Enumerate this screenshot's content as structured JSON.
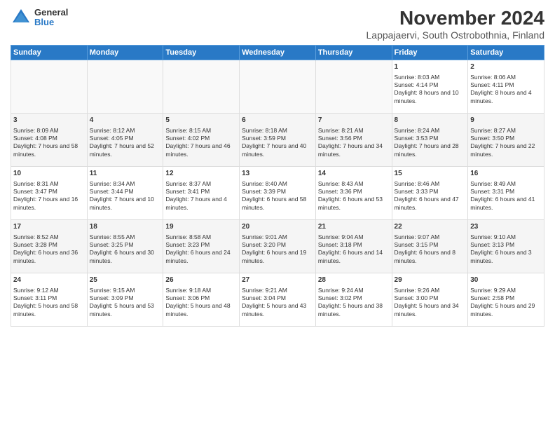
{
  "logo": {
    "general": "General",
    "blue": "Blue"
  },
  "title": "November 2024",
  "subtitle": "Lappajaervi, South Ostrobothnia, Finland",
  "days_of_week": [
    "Sunday",
    "Monday",
    "Tuesday",
    "Wednesday",
    "Thursday",
    "Friday",
    "Saturday"
  ],
  "weeks": [
    [
      {
        "day": "",
        "content": ""
      },
      {
        "day": "",
        "content": ""
      },
      {
        "day": "",
        "content": ""
      },
      {
        "day": "",
        "content": ""
      },
      {
        "day": "",
        "content": ""
      },
      {
        "day": "1",
        "content": "Sunrise: 8:03 AM\nSunset: 4:14 PM\nDaylight: 8 hours and 10 minutes."
      },
      {
        "day": "2",
        "content": "Sunrise: 8:06 AM\nSunset: 4:11 PM\nDaylight: 8 hours and 4 minutes."
      }
    ],
    [
      {
        "day": "3",
        "content": "Sunrise: 8:09 AM\nSunset: 4:08 PM\nDaylight: 7 hours and 58 minutes."
      },
      {
        "day": "4",
        "content": "Sunrise: 8:12 AM\nSunset: 4:05 PM\nDaylight: 7 hours and 52 minutes."
      },
      {
        "day": "5",
        "content": "Sunrise: 8:15 AM\nSunset: 4:02 PM\nDaylight: 7 hours and 46 minutes."
      },
      {
        "day": "6",
        "content": "Sunrise: 8:18 AM\nSunset: 3:59 PM\nDaylight: 7 hours and 40 minutes."
      },
      {
        "day": "7",
        "content": "Sunrise: 8:21 AM\nSunset: 3:56 PM\nDaylight: 7 hours and 34 minutes."
      },
      {
        "day": "8",
        "content": "Sunrise: 8:24 AM\nSunset: 3:53 PM\nDaylight: 7 hours and 28 minutes."
      },
      {
        "day": "9",
        "content": "Sunrise: 8:27 AM\nSunset: 3:50 PM\nDaylight: 7 hours and 22 minutes."
      }
    ],
    [
      {
        "day": "10",
        "content": "Sunrise: 8:31 AM\nSunset: 3:47 PM\nDaylight: 7 hours and 16 minutes."
      },
      {
        "day": "11",
        "content": "Sunrise: 8:34 AM\nSunset: 3:44 PM\nDaylight: 7 hours and 10 minutes."
      },
      {
        "day": "12",
        "content": "Sunrise: 8:37 AM\nSunset: 3:41 PM\nDaylight: 7 hours and 4 minutes."
      },
      {
        "day": "13",
        "content": "Sunrise: 8:40 AM\nSunset: 3:39 PM\nDaylight: 6 hours and 58 minutes."
      },
      {
        "day": "14",
        "content": "Sunrise: 8:43 AM\nSunset: 3:36 PM\nDaylight: 6 hours and 53 minutes."
      },
      {
        "day": "15",
        "content": "Sunrise: 8:46 AM\nSunset: 3:33 PM\nDaylight: 6 hours and 47 minutes."
      },
      {
        "day": "16",
        "content": "Sunrise: 8:49 AM\nSunset: 3:31 PM\nDaylight: 6 hours and 41 minutes."
      }
    ],
    [
      {
        "day": "17",
        "content": "Sunrise: 8:52 AM\nSunset: 3:28 PM\nDaylight: 6 hours and 36 minutes."
      },
      {
        "day": "18",
        "content": "Sunrise: 8:55 AM\nSunset: 3:25 PM\nDaylight: 6 hours and 30 minutes."
      },
      {
        "day": "19",
        "content": "Sunrise: 8:58 AM\nSunset: 3:23 PM\nDaylight: 6 hours and 24 minutes."
      },
      {
        "day": "20",
        "content": "Sunrise: 9:01 AM\nSunset: 3:20 PM\nDaylight: 6 hours and 19 minutes."
      },
      {
        "day": "21",
        "content": "Sunrise: 9:04 AM\nSunset: 3:18 PM\nDaylight: 6 hours and 14 minutes."
      },
      {
        "day": "22",
        "content": "Sunrise: 9:07 AM\nSunset: 3:15 PM\nDaylight: 6 hours and 8 minutes."
      },
      {
        "day": "23",
        "content": "Sunrise: 9:10 AM\nSunset: 3:13 PM\nDaylight: 6 hours and 3 minutes."
      }
    ],
    [
      {
        "day": "24",
        "content": "Sunrise: 9:12 AM\nSunset: 3:11 PM\nDaylight: 5 hours and 58 minutes."
      },
      {
        "day": "25",
        "content": "Sunrise: 9:15 AM\nSunset: 3:09 PM\nDaylight: 5 hours and 53 minutes."
      },
      {
        "day": "26",
        "content": "Sunrise: 9:18 AM\nSunset: 3:06 PM\nDaylight: 5 hours and 48 minutes."
      },
      {
        "day": "27",
        "content": "Sunrise: 9:21 AM\nSunset: 3:04 PM\nDaylight: 5 hours and 43 minutes."
      },
      {
        "day": "28",
        "content": "Sunrise: 9:24 AM\nSunset: 3:02 PM\nDaylight: 5 hours and 38 minutes."
      },
      {
        "day": "29",
        "content": "Sunrise: 9:26 AM\nSunset: 3:00 PM\nDaylight: 5 hours and 34 minutes."
      },
      {
        "day": "30",
        "content": "Sunrise: 9:29 AM\nSunset: 2:58 PM\nDaylight: 5 hours and 29 minutes."
      }
    ]
  ]
}
